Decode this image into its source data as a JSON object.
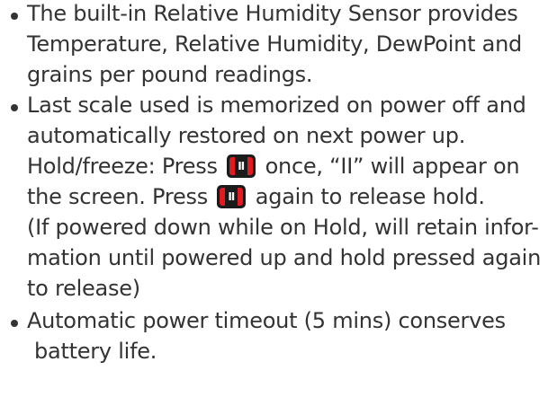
{
  "bullets": [
    {
      "lines": [
        "The built-in Relative Humidity Sensor provides",
        "Temperature, Relative Humidity, DewPoint and",
        "grains per pound readings."
      ]
    },
    {
      "lines": [
        "Last scale used is memorized on power off and",
        "automatically restored on next power up."
      ],
      "hold": {
        "line1_before": "Hold/freeze: Press",
        "line1_after": " once,  “II” will appear on",
        "line2_before": "the screen. Press",
        "line2_after": " again to release hold."
      },
      "lines_after": [
        "(If powered down while on Hold, will retain infor-",
        "mation until powered up and hold pressed again",
        "to release)"
      ]
    },
    {
      "lines": [
        "Automatic power timeout (5 mins) conserves",
        "battery life."
      ]
    }
  ],
  "icons": {
    "hold_button": "hold-button-icon",
    "hold_glyph": "Ⅱ",
    "accent_color": "#e21a22",
    "body_color": "#1b1b1b"
  }
}
